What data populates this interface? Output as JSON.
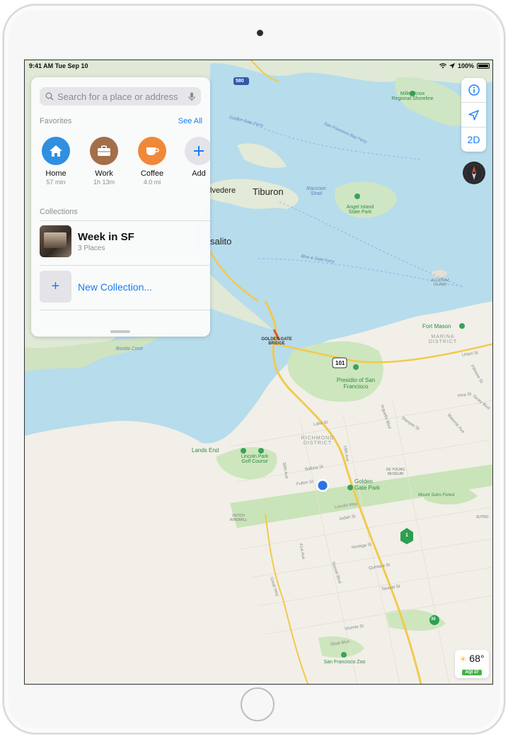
{
  "status_bar": {
    "time": "9:41 AM",
    "date": "Tue Sep 10",
    "battery": "100%"
  },
  "search": {
    "placeholder": "Search for a place or address"
  },
  "favorites": {
    "title": "Favorites",
    "see_all": "See All",
    "items": [
      {
        "label": "Home",
        "sub": "57 min",
        "icon": "house-icon",
        "color": "#2f8fe0"
      },
      {
        "label": "Work",
        "sub": "1h 13m",
        "icon": "briefcase-icon",
        "color": "#a36f4a"
      },
      {
        "label": "Coffee",
        "sub": "4.0 mi",
        "icon": "coffee-cup-icon",
        "color": "#f0883a"
      },
      {
        "label": "Add",
        "icon": "plus-icon",
        "color": "#e4e4e8"
      }
    ]
  },
  "collections": {
    "title": "Collections",
    "items": [
      {
        "title": "Week in SF",
        "sub": "3 Places"
      }
    ],
    "new_label": "New Collection..."
  },
  "controls": {
    "mode_2d": "2D"
  },
  "weather": {
    "temp": "68°",
    "aqi": "AQI 37"
  },
  "map_labels": {
    "tiburon": "Tiburon",
    "belvedere": "lvedere",
    "sausalito": "salito",
    "raccoon_strait": "Raccoon Strait",
    "angel_island": "Angel Island State Park",
    "miller_knox": "Miller Knox Regional Shoreline",
    "golden_gate_ferry": "Golden Gate Ferry",
    "sf_bay_ferry": "San Francisco Bay Ferry",
    "blue_gold_ferry": "Blue & Gold Ferry",
    "golden_gate_bridge": "GOLDEN GATE BRIDGE",
    "alcatraz": "ALCATRAZ ISLAND",
    "fort_mason": "Fort Mason",
    "marina": "MARINA DISTRICT",
    "bonita_cove": "Bonita Cove",
    "presidio": "Presidio of San Francisco",
    "richmond": "RICHMOND DISTRICT",
    "lands_end": "Lands End",
    "lincoln_park": "Lincoln Park Golf Course",
    "golden_gate_park": "Golden Gate Park",
    "de_young": "DE YOUNG MUSEUM",
    "mount_sutro": "Mount Sutro Forest",
    "dutch_windmill": "DUTCH WINDMILL",
    "sf_zoo": "San Francisco Zoo",
    "route_101": "101",
    "route_580": "580",
    "route_1": "1",
    "route_35": "35",
    "lake_st": "Lake St",
    "balboa_st": "Balboa St",
    "fulton_st": "Fulton St",
    "lincoln_way": "Lincoln Way",
    "judah_st": "Judah St",
    "noriega_st": "Noriega St",
    "quintara_st": "Quintara St",
    "taraval_st": "Taraval St",
    "vicente_st": "Vicente St",
    "sloat_blvd": "Sloat Blvd",
    "sunset_blvd": "Sunset Blvd",
    "great_hwy": "Great Hwy",
    "forty_first_ave": "41st Ave",
    "thirtieth_ave": "30th Ave",
    "nineteenth_ave": "19th Ave",
    "arguello_blvd": "Arguello Blvd",
    "stanyan_st": "Stanyan St",
    "masonic_ave": "Masonic Ave",
    "union_st": "Union St",
    "pine_st": "Pine St",
    "fillmore_st": "Fillmore St",
    "geary_blvd": "Geary Blvd",
    "sutro": "SUTRO"
  }
}
